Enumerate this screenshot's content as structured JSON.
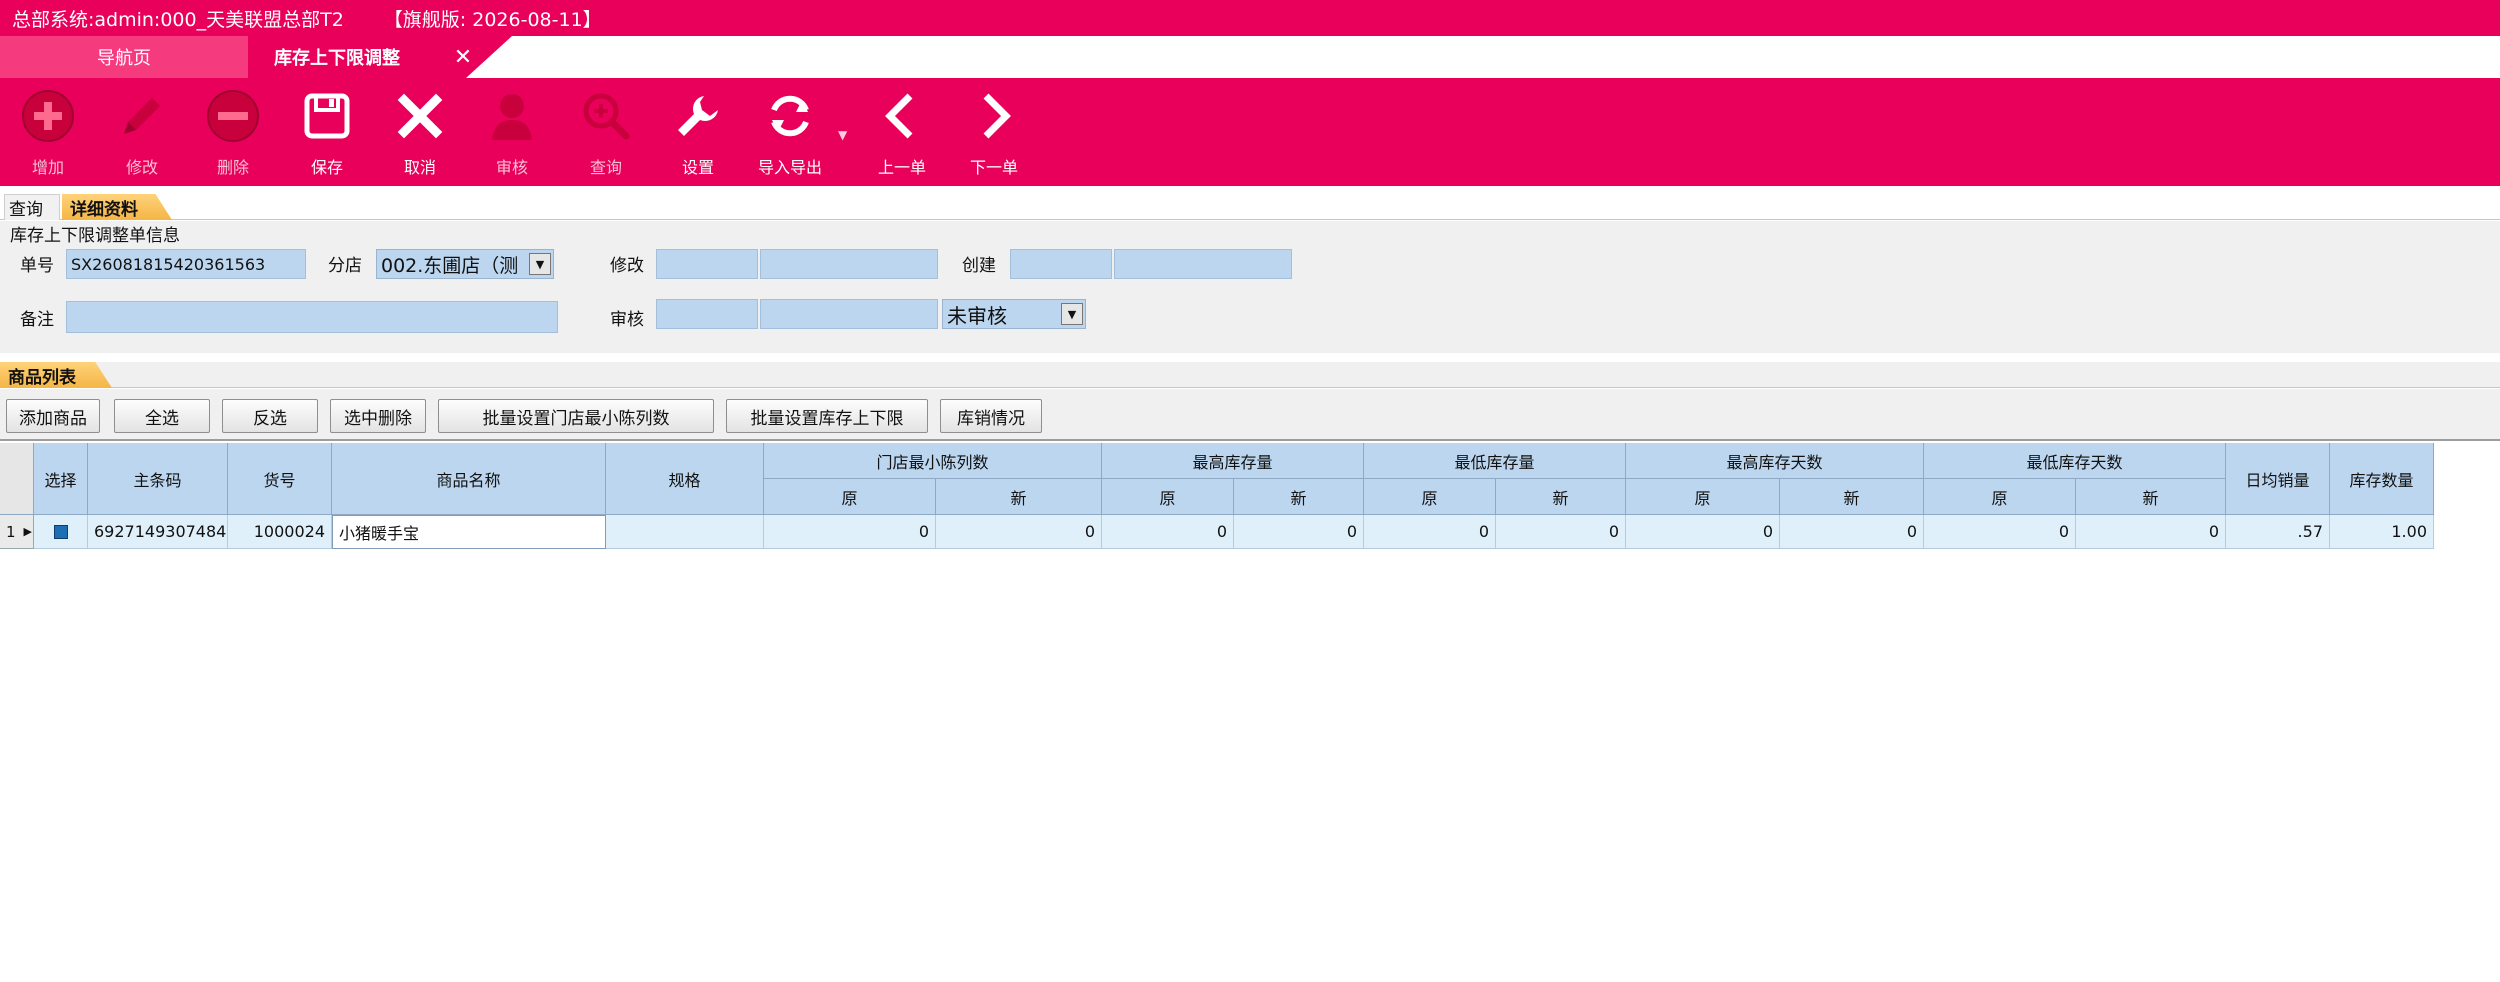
{
  "title": {
    "system": "总部系统:admin:000_天美联盟总部T2",
    "edition": "【旗舰版: 2026-08-11】"
  },
  "tabs": {
    "nav": "导航页",
    "active": "库存上下限调整",
    "close": "✕"
  },
  "toolbar": [
    {
      "id": "add",
      "label": "增加",
      "icon": "plus-circle-icon"
    },
    {
      "id": "edit",
      "label": "修改",
      "icon": "pencil-icon"
    },
    {
      "id": "delete",
      "label": "删除",
      "icon": "minus-circle-icon"
    },
    {
      "id": "save",
      "label": "保存",
      "icon": "floppy-disk-icon"
    },
    {
      "id": "cancel",
      "label": "取消",
      "icon": "close-x-icon"
    },
    {
      "id": "audit",
      "label": "审核",
      "icon": "person-icon"
    },
    {
      "id": "query",
      "label": "查询",
      "icon": "zoom-in-icon"
    },
    {
      "id": "settings",
      "label": "设置",
      "icon": "wrench-icon"
    },
    {
      "id": "importexport",
      "label": "导入导出",
      "icon": "refresh-icon"
    },
    {
      "id": "prev",
      "label": "上一单",
      "icon": "chevron-left-icon"
    },
    {
      "id": "next",
      "label": "下一单",
      "icon": "chevron-right-icon"
    }
  ],
  "subtabs": {
    "query": "查询",
    "detail": "详细资料"
  },
  "form": {
    "title": "库存上下限调整单信息",
    "no_label": "单号",
    "no_value": "SX26081815420361563",
    "branch_label": "分店",
    "branch_value": "002.东圃店（测",
    "modify_label": "修改",
    "create_label": "创建",
    "remark_label": "备注",
    "audit_label": "审核",
    "audit_status": "未审核"
  },
  "plist": {
    "tab": "商品列表",
    "buttons": [
      "添加商品",
      "全选",
      "反选",
      "选中删除",
      "批量设置门店最小陈列数",
      "批量设置库存上下限",
      "库销情况"
    ]
  },
  "grid": {
    "headers": {
      "select": "选择",
      "barcode": "主条码",
      "itemno": "货号",
      "name": "商品名称",
      "spec": "规格",
      "min_display": "门店最小陈列数",
      "max_stock": "最高库存量",
      "min_stock": "最低库存量",
      "max_days": "最高库存天数",
      "min_days": "最低库存天数",
      "orig": "原",
      "new": "新",
      "daily_sales": "日均销量",
      "stock_qty": "库存数量"
    },
    "rows": [
      {
        "index": "1",
        "barcode": "6927149307484",
        "itemno": "1000024",
        "name": "小猪暖手宝",
        "spec": "",
        "min_display_orig": "0",
        "min_display_new": "0",
        "max_stock_orig": "0",
        "max_stock_new": "0",
        "min_stock_orig": "0",
        "min_stock_new": "0",
        "max_days_orig": "0",
        "max_days_new": "0",
        "min_days_orig": "0",
        "min_days_new": "0",
        "daily_sales": ".57",
        "stock_qty": "1.00"
      }
    ]
  }
}
